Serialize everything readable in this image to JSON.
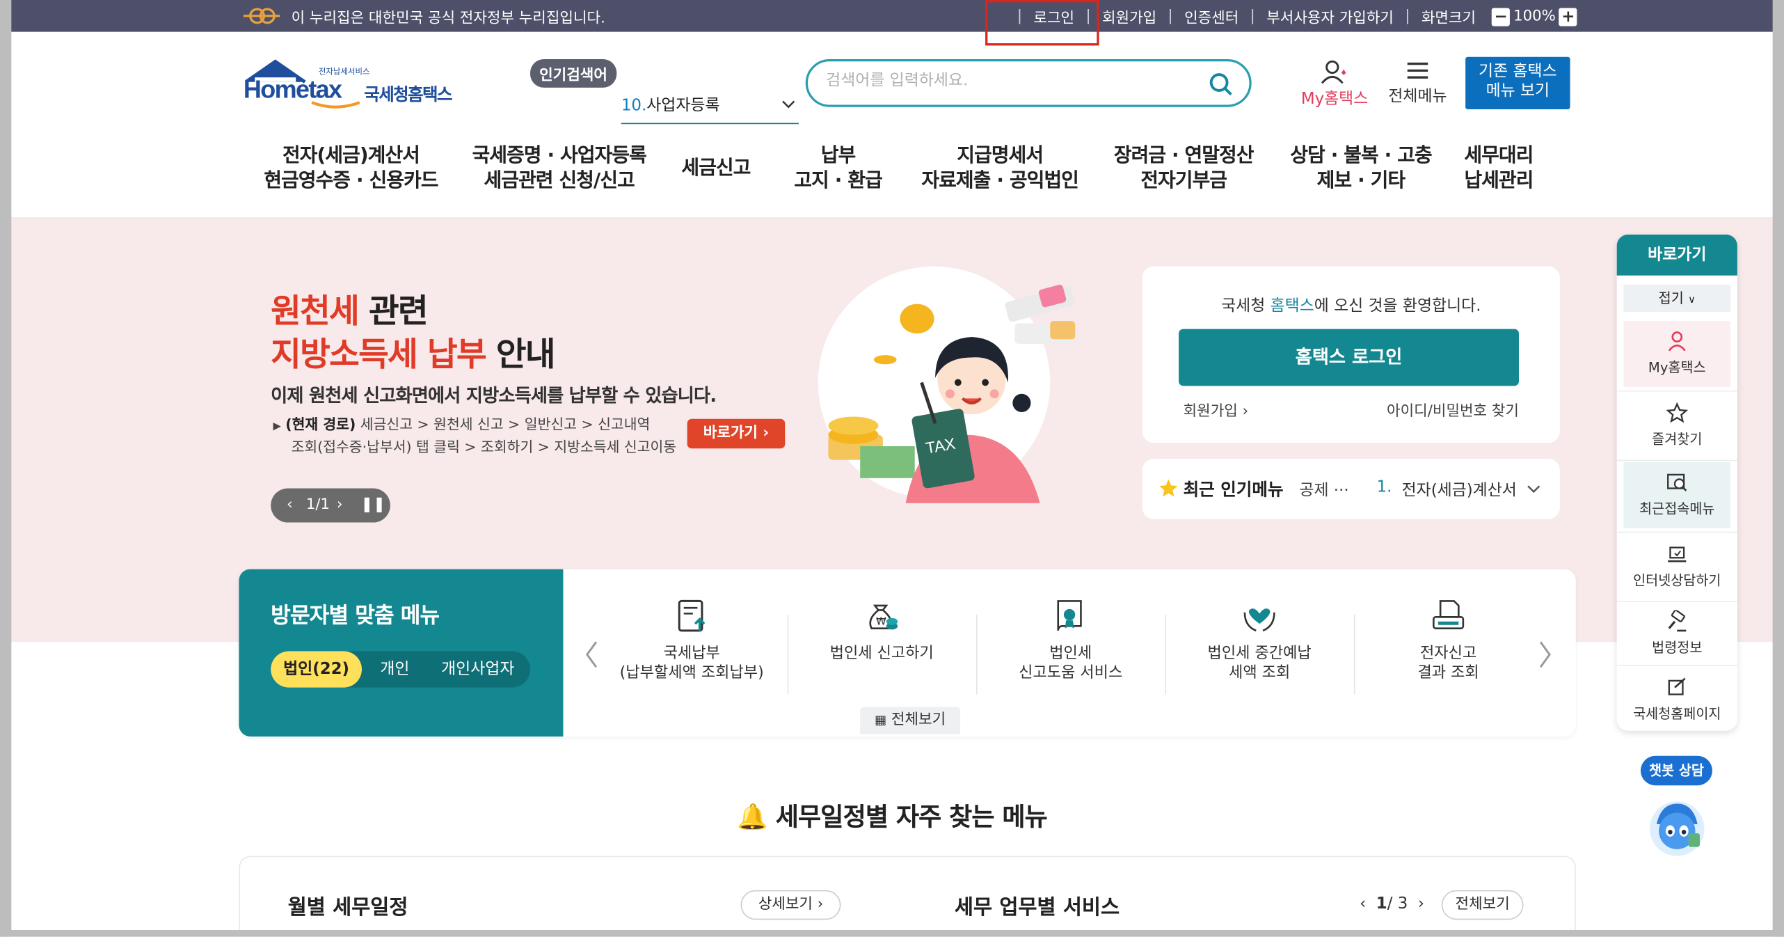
{
  "gov_bar": {
    "notice": "이 누리집은 대한민국 공식 전자정부 누리집입니다.",
    "links": [
      "로그인",
      "회원가입",
      "인증센터",
      "부서사용자 가입하기",
      "화면크기"
    ],
    "zoom": "100%",
    "zoom_minus": "−",
    "zoom_plus": "+",
    "separator": "|"
  },
  "header": {
    "logo_text": "Hometax",
    "logo_sub": "국세청홈택스",
    "logo_small": "전자납세서비스",
    "popular_tag": "인기검색어",
    "popular_rank": "10.",
    "popular_term": "사업자등록",
    "search_placeholder": "검색어를 입력하세요.",
    "my_hometax": "My홈택스",
    "all_menu": "전체메뉴",
    "old_site_line1": "기존 홈택스",
    "old_site_line2": "메뉴 보기"
  },
  "gnb": [
    {
      "l1": "전자(세금)계산서",
      "l2": "현금영수증 · 신용카드"
    },
    {
      "l1": "국세증명 · 사업자등록",
      "l2": "세금관련 신청/신고"
    },
    {
      "l1": "세금신고",
      "l2": ""
    },
    {
      "l1": "납부",
      "l2": "고지 · 환급"
    },
    {
      "l1": "지급명세서",
      "l2": "자료제출 · 공익법인"
    },
    {
      "l1": "장려금 · 연말정산",
      "l2": "전자기부금"
    },
    {
      "l1": "상담 · 불복 · 고충",
      "l2": "제보 · 기타"
    },
    {
      "l1": "세무대리",
      "l2": "납세관리"
    }
  ],
  "banner": {
    "title1_red": "원천세",
    "title1_rest": " 관련",
    "title2_red": "지방소득세 납부",
    "title2_rest": " 안내",
    "subtitle": "이제 원천세 신고화면에서 지방소득세를 납부할 수 있습니다.",
    "path_label": "(현재 경로)",
    "path_line1": " 세금신고 > 원천세 신고 > 일반신고 > 신고내역",
    "path_line2": "조회(접수증·납부서) 탭 클릭 > 조회하기 > 지방소득세 신고이동",
    "goto": "바로가기",
    "counter": "1/1",
    "illustration_text": "TAX"
  },
  "login_card": {
    "welcome_pre": "국세청 ",
    "welcome_hl": "홈택스",
    "welcome_post": "에 오신 것을 환영합니다.",
    "login_button": "홈택스 로그인",
    "join": "회원가입",
    "find": "아이디/비밀번호 찾기"
  },
  "hot_menu": {
    "title": "최근 인기메뉴",
    "keyword": "공제 ···",
    "rank": "1.",
    "item": "전자(세금)계산서"
  },
  "custom_menu": {
    "title": "방문자별 맞춤 메뉴",
    "tabs": [
      "법인(22)",
      "개인",
      "개인사업자"
    ],
    "items": [
      {
        "l1": "국세납부",
        "l2": "(납부할세액 조회납부)",
        "icon": "document-upload-icon"
      },
      {
        "l1": "법인세 신고하기",
        "l2": "",
        "icon": "money-bag-icon"
      },
      {
        "l1": "법인세",
        "l2": "신고도움 서비스",
        "icon": "certificate-icon"
      },
      {
        "l1": "법인세 중간예납",
        "l2": "세액 조회",
        "icon": "heart-hands-icon"
      },
      {
        "l1": "전자신고",
        "l2": "결과 조회",
        "icon": "printer-report-icon"
      }
    ],
    "all_view": "전체보기"
  },
  "schedule": {
    "section_title": "세무일정별 자주 찾는 메뉴",
    "monthly": "월별 세무일정",
    "detail": "상세보기",
    "service": "세무 업무별 서비스",
    "page_current": "1",
    "page_total": "/ 3",
    "all_view": "전체보기"
  },
  "quick_menu": {
    "title": "바로가기",
    "fold": "접기",
    "items": [
      "My홈택스",
      "즐겨찾기",
      "최근접속메뉴",
      "인터넷상담하기",
      "법령정보",
      "국세청홈페이지"
    ]
  },
  "chatbot": {
    "label": "챗봇 상담"
  },
  "colors": {
    "teal": "#138891",
    "accent_red": "#e03b27",
    "gov_bar": "#4d5068",
    "banner_bg": "#f8e9ea",
    "highlight_box": "#d9261c"
  }
}
